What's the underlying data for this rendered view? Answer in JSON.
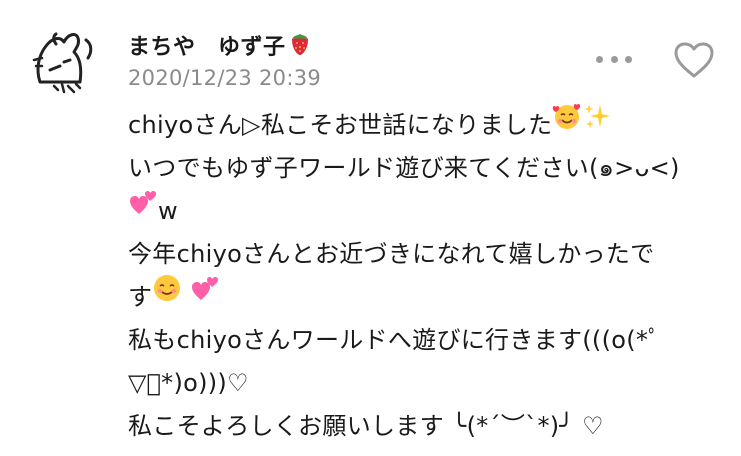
{
  "comment": {
    "username": "まちや　ゆず子",
    "timestamp": "2020/12/23 20:39",
    "body_lines": [
      "chiyoさん▷私こそお世話になりました",
      "いつでもゆず子ワールド遊び来てください(๑>ᴗ<)",
      "w",
      "今年chiyoさんとお近づきになれて嬉しかったで",
      "す",
      "私もchiyoさんワールドへ遊びに行きます(((o(*ﾟ",
      "▽ﾟ*)o)))♡",
      "私こそよろしくお願いします ╰(*´︶`*)╯ ♡"
    ]
  },
  "icons": {
    "avatar": "doodle-avatar-icon",
    "username_suffix": "strawberry-icon",
    "more": "more-dots-icon",
    "like": "heart-outline-icon",
    "emoji_1": "smiling-face-with-hearts-icon",
    "emoji_2": "sparkles-icon",
    "emoji_3": "two-hearts-icon",
    "emoji_4": "smiling-face-icon",
    "emoji_5": "two-hearts-icon"
  },
  "colors": {
    "username": "#1a1a1a",
    "timestamp": "#8a8a8a",
    "icon_gray": "#9a9a9a",
    "heart_pink": "#ff5fa8",
    "strawberry_red": "#e0283a"
  }
}
